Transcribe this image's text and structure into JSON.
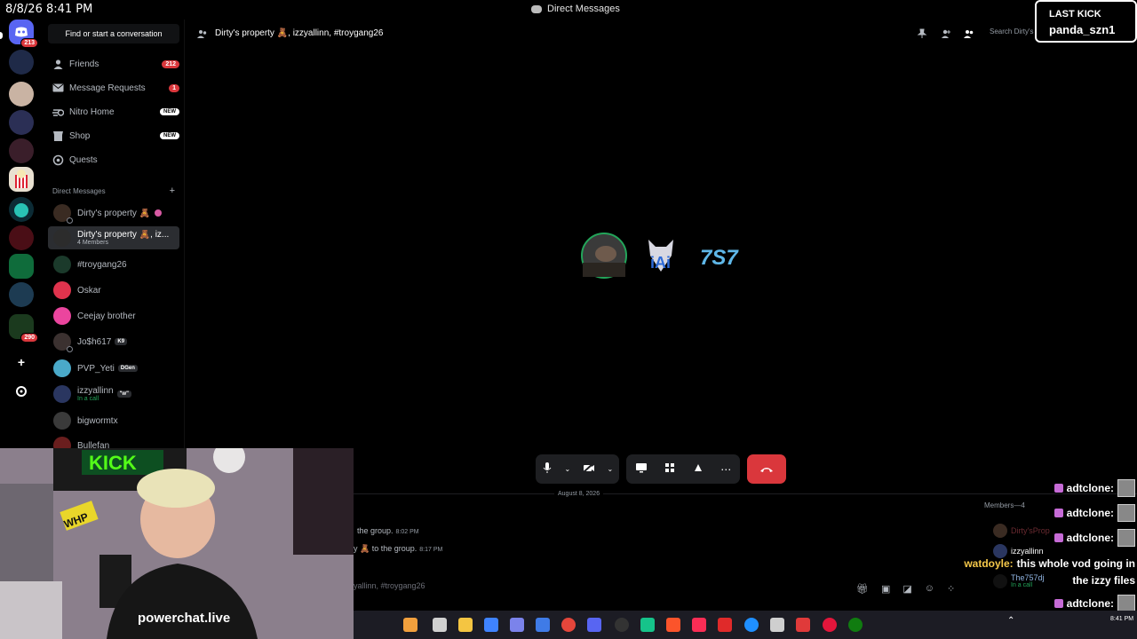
{
  "titlebar": {
    "datetime": "8/8/26 8:41 PM",
    "window_title": "Direct Messages"
  },
  "rail": {
    "badge_home": "213",
    "badge_290": "290"
  },
  "sidebar": {
    "find": "Find or start a conversation",
    "nav": [
      {
        "label": "Friends",
        "count": "212"
      },
      {
        "label": "Message Requests",
        "count": "1"
      },
      {
        "label": "Nitro Home",
        "tag": "NEW"
      },
      {
        "label": "Shop",
        "tag": "NEW"
      },
      {
        "label": "Quests"
      }
    ],
    "dm_header": "Direct Messages",
    "dms": [
      {
        "name": "Dirty's property 🧸"
      },
      {
        "name": "Dirty's property 🧸, iz...",
        "sub": "4 Members"
      },
      {
        "name": "#troygang26"
      },
      {
        "name": "Oskar"
      },
      {
        "name": "Ceejay brother"
      },
      {
        "name": "Jo$h617",
        "tag": "K9"
      },
      {
        "name": "PVP_Yeti",
        "tag": "DGen"
      },
      {
        "name": "izzyallinn",
        "sub": "In a call",
        "tag": "\"w\""
      },
      {
        "name": "bigwormtx"
      },
      {
        "name": "Bullefan"
      }
    ]
  },
  "call": {
    "title": "Dirty's property 🧸, izzyallinn, #troygang26",
    "search_placeholder": "Search Dirty's property"
  },
  "chat": {
    "date_divider": "August 8, 2026",
    "messages": [
      {
        "text": "the group.",
        "time": "8:02 PM"
      },
      {
        "text": "y 🧸 to the group.",
        "time": "8:17 PM"
      }
    ],
    "input_placeholder": "yallinn, #troygang26",
    "members_header": "Members—4",
    "members": [
      {
        "name": "Dirty'sProp",
        "status": ""
      },
      {
        "name": "izzyallinn",
        "status": ""
      },
      {
        "name": "The757dj",
        "status": "In a call"
      }
    ]
  },
  "overlay": {
    "kick_title": "LAST KICK",
    "kick_user": "panda_szn1",
    "chat_lines": [
      {
        "user": "adtclone:",
        "text": ""
      },
      {
        "user": "adtclone:",
        "text": ""
      },
      {
        "user": "adtclone:",
        "text": ""
      },
      {
        "user": "watdoyle:",
        "text": "this whole vod going in"
      },
      {
        "user": "",
        "text": "the izzy files"
      },
      {
        "user": "adtclone:",
        "text": ""
      },
      {
        "user": "adtclone:",
        "text": ""
      }
    ]
  },
  "webcam": {
    "sign": "KICK",
    "shirt": "powerchat.live",
    "cap": "WHP"
  },
  "taskbar": {
    "time": "8:41 PM"
  },
  "colors": {
    "accent": "#5865f2",
    "danger": "#da373c",
    "online": "#23a55a"
  }
}
